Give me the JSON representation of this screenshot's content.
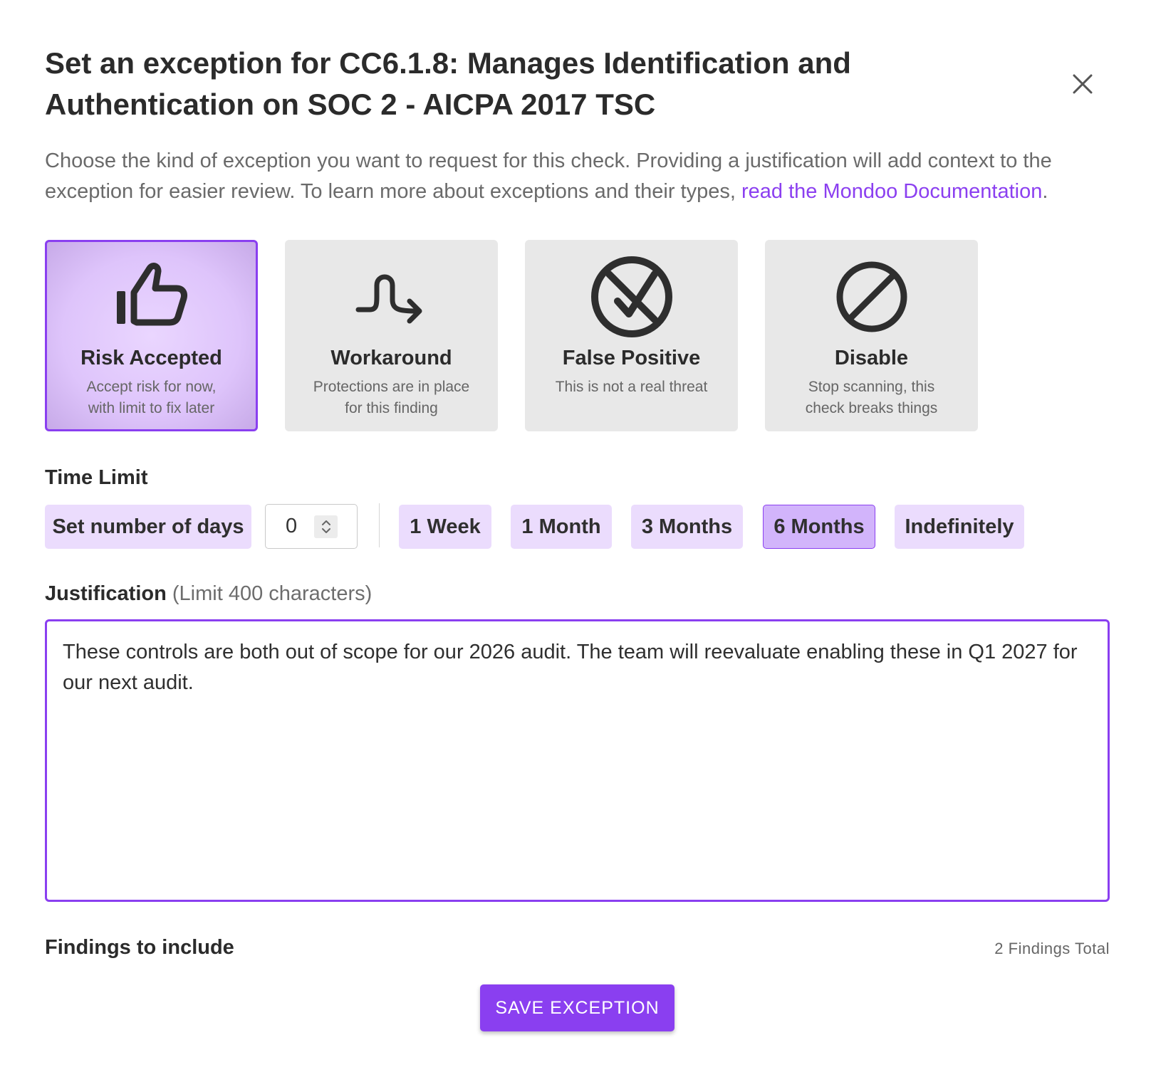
{
  "dialog": {
    "title": "Set an exception for CC6.1.8: Manages Identification and Authentication on SOC 2 - AICPA 2017 TSC",
    "description_text": "Choose the kind of exception you want to request for this check. Providing a justification will add context to the exception for easier review. To learn more about exceptions and their types, ",
    "description_link": "read the Mondoo Documentation",
    "description_end": "."
  },
  "exception_types": [
    {
      "title": "Risk Accepted",
      "desc_line1": "Accept risk for now,",
      "desc_line2": "with limit to fix later",
      "icon": "thumbs-up-icon",
      "selected": true
    },
    {
      "title": "Workaround",
      "desc_line1": "Protections are in place",
      "desc_line2": "for this finding",
      "icon": "workaround-arrow-icon",
      "selected": false
    },
    {
      "title": "False Positive",
      "desc_line1": "This is not a real threat",
      "desc_line2": "",
      "icon": "circle-x-check-icon",
      "selected": false
    },
    {
      "title": "Disable",
      "desc_line1": "Stop scanning, this",
      "desc_line2": "check breaks things",
      "icon": "disable-slash-icon",
      "selected": false
    }
  ],
  "time_limit": {
    "label": "Time Limit",
    "set_days_label": "Set number of days",
    "days_value": "0",
    "options": [
      "1 Week",
      "1 Month",
      "3 Months",
      "6 Months",
      "Indefinitely"
    ],
    "selected": "6 Months"
  },
  "justification": {
    "label": "Justification",
    "limit_note": "(Limit 400 characters)",
    "value": "These controls are both out of scope for our 2026 audit. The team will reevaluate enabling these in Q1 2027 for our next audit."
  },
  "findings": {
    "label": "Findings to include",
    "total": "2 Findings Total"
  },
  "save_label": "SAVE EXCEPTION",
  "colors": {
    "accent": "#8a3ff0",
    "chip": "#ebdcfd",
    "chip_active": "#d2b4fb",
    "card": "#e8e8e8"
  }
}
